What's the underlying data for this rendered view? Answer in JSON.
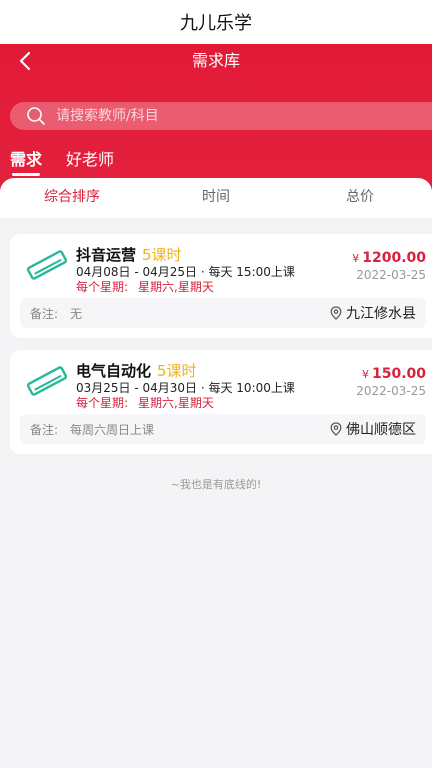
{
  "app": {
    "title": "九儿乐学"
  },
  "nav": {
    "title": "需求库"
  },
  "search": {
    "placeholder": "请搜索教师/科目",
    "value": ""
  },
  "top_tabs": [
    {
      "label": "需求",
      "active": true
    },
    {
      "label": "好老师",
      "active": false
    }
  ],
  "sort_tabs": [
    {
      "label": "综合排序",
      "active": true
    },
    {
      "label": "时间",
      "active": false
    },
    {
      "label": "总价",
      "active": false
    }
  ],
  "cards": [
    {
      "subject": "抖音运营",
      "hours": "5课时",
      "time": "04月08日 - 04月25日 · 每天 15:00上课",
      "weekly_label": "每个星期:",
      "weekly_days": "星期六,星期天",
      "price_symbol": "¥",
      "price": "1200.00",
      "date": "2022-03-25",
      "note_label": "备注:",
      "note": "无",
      "location": "九江修水县"
    },
    {
      "subject": "电气自动化",
      "hours": "5课时",
      "time": "03月25日 - 04月30日 · 每天 10:00上课",
      "weekly_label": "每个星期:",
      "weekly_days": "星期六,星期天",
      "price_symbol": "¥",
      "price": "150.00",
      "date": "2022-03-25",
      "note_label": "备注:",
      "note": "每周六周日上课",
      "location": "佛山顺德区"
    }
  ],
  "footer": {
    "text": "~我也是有底线的!"
  },
  "colors": {
    "brand_red": "#e11a36",
    "accent_yellow": "#f0b31c",
    "icon_teal": "#27b89a"
  },
  "icons": [
    "back-arrow-icon",
    "search-icon",
    "ruler-icon",
    "location-pin-icon"
  ]
}
